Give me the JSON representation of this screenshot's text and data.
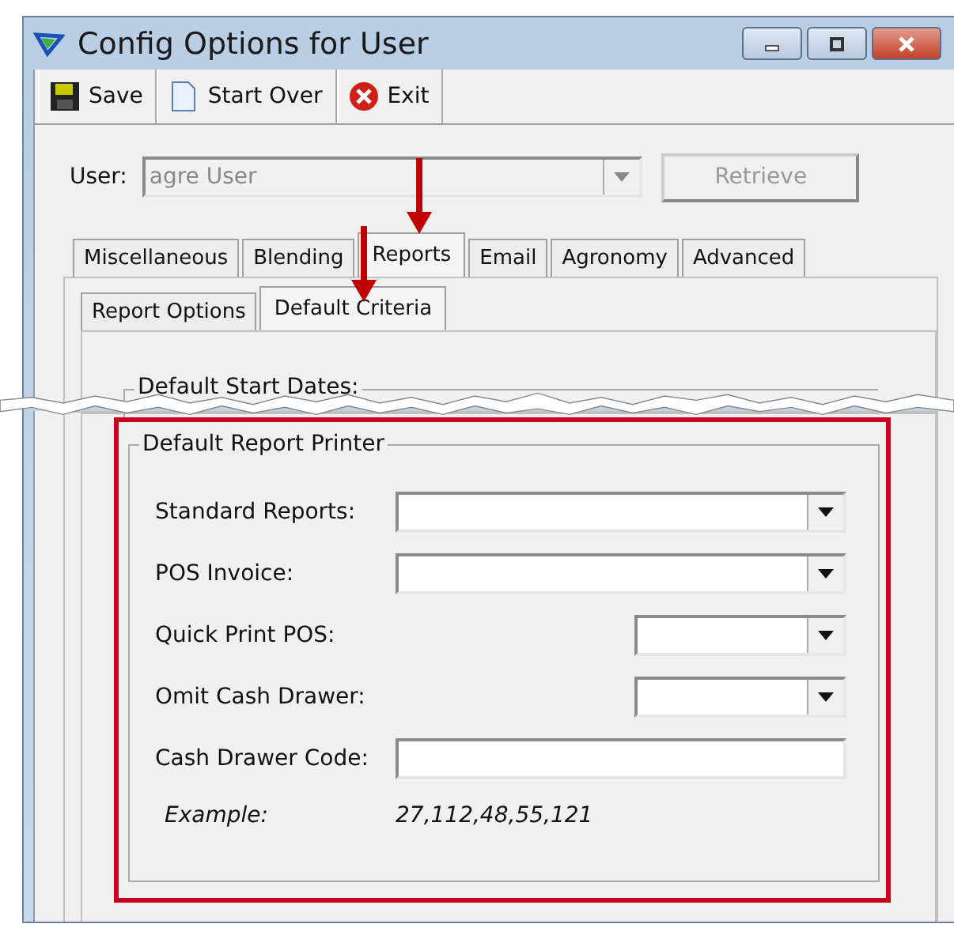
{
  "window": {
    "title": "Config Options for User"
  },
  "toolbar": [
    {
      "kind": "save",
      "label": "Save"
    },
    {
      "kind": "new",
      "label": "Start Over"
    },
    {
      "kind": "exit",
      "label": "Exit"
    }
  ],
  "user": {
    "label": "User:",
    "value": "agre User",
    "disabled": true
  },
  "retrieve_button": {
    "label": "Retrieve",
    "disabled": true
  },
  "tabs": [
    {
      "label": "Miscellaneous",
      "selected": false
    },
    {
      "label": "Blending",
      "selected": false
    },
    {
      "label": "Reports",
      "selected": true
    },
    {
      "label": "Email",
      "selected": false
    },
    {
      "label": "Agronomy",
      "selected": false
    },
    {
      "label": "Advanced",
      "selected": false
    }
  ],
  "subtabs": [
    {
      "label": "Report Options",
      "selected": false
    },
    {
      "label": "Default Criteria",
      "selected": true
    }
  ],
  "start_dates_group": {
    "title": "Default Start Dates:"
  },
  "printer_group": {
    "title": "Default Report Printer",
    "fields": [
      {
        "kind": "combo",
        "label": "Standard Reports:"
      },
      {
        "kind": "combo",
        "label": "POS Invoice:"
      },
      {
        "kind": "short-combo",
        "label": "Quick Print POS:"
      },
      {
        "kind": "short-combo",
        "label": "Omit Cash Drawer:"
      },
      {
        "kind": "text",
        "label": "Cash Drawer Code:"
      }
    ],
    "example": {
      "label": "Example:",
      "value": "27,112,48,55,121"
    }
  }
}
